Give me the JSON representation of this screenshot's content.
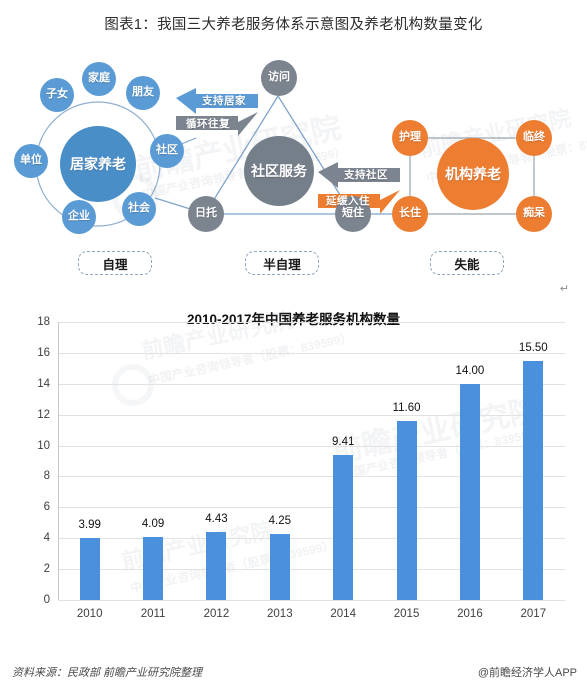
{
  "figure": {
    "caption": "图表1：我国三大养老服务体系示意图及养老机构数量变化",
    "return_mark": "↵"
  },
  "diagram": {
    "clusters": [
      {
        "id": "home-care",
        "center": "居家养老",
        "center_color": "#4A8EC8",
        "node_color": "#5B9BD5",
        "category": "自理",
        "satellites": [
          "家庭",
          "朋友",
          "社区",
          "社会",
          "企业",
          "单位",
          "子女"
        ]
      },
      {
        "id": "community-service",
        "center": "社区服务",
        "center_color": "#757F8A",
        "node_color": "#7C8490",
        "category": "半自理",
        "satellites": [
          "访问",
          "短住",
          "日托"
        ]
      },
      {
        "id": "institutional-care",
        "center": "机构养老",
        "center_color": "#ED7D31",
        "node_color": "#ED7D31",
        "category": "失能",
        "satellites": [
          "护理",
          "临终",
          "痴呆",
          "长住"
        ]
      }
    ],
    "arrows": [
      {
        "id": "support-home",
        "label": "支持居家",
        "color": "#5B9BD5",
        "direction": "left"
      },
      {
        "id": "cycle-back",
        "label": "循环往复",
        "color": "#7C8490",
        "direction": "right"
      },
      {
        "id": "support-community",
        "label": "支持社区",
        "color": "#7C8490",
        "direction": "left"
      },
      {
        "id": "delay-admission",
        "label": "延缓入住",
        "color": "#ED7D31",
        "direction": "right"
      }
    ]
  },
  "chart_data": {
    "type": "bar",
    "title": "2010-2017年中国养老服务机构数量",
    "xlabel": "",
    "ylabel": "",
    "categories": [
      "2010",
      "2011",
      "2012",
      "2013",
      "2014",
      "2015",
      "2016",
      "2017"
    ],
    "values": [
      3.99,
      4.09,
      4.43,
      4.25,
      9.41,
      11.6,
      14.0,
      15.5
    ],
    "value_labels": [
      "3.99",
      "4.09",
      "4.43",
      "4.25",
      "9.41",
      "11.60",
      "14.00",
      "15.50"
    ],
    "yticks": [
      0,
      2,
      4,
      6,
      8,
      10,
      12,
      14,
      16,
      18
    ],
    "ytick_labels": [
      "0",
      "2",
      "4",
      "6",
      "8",
      "10",
      "12",
      "14",
      "16",
      "18"
    ],
    "ylim": [
      0,
      18
    ],
    "grid": true,
    "legend": false,
    "bar_color": "#4A90DC"
  },
  "footer": {
    "source": "资料来源：民政部 前瞻产业研究院整理",
    "brand": "@前瞻经济学人APP"
  },
  "watermark": {
    "text_a": "前瞻产业研究院",
    "text_b": "中国产业咨询领导者（股票：839599）"
  }
}
